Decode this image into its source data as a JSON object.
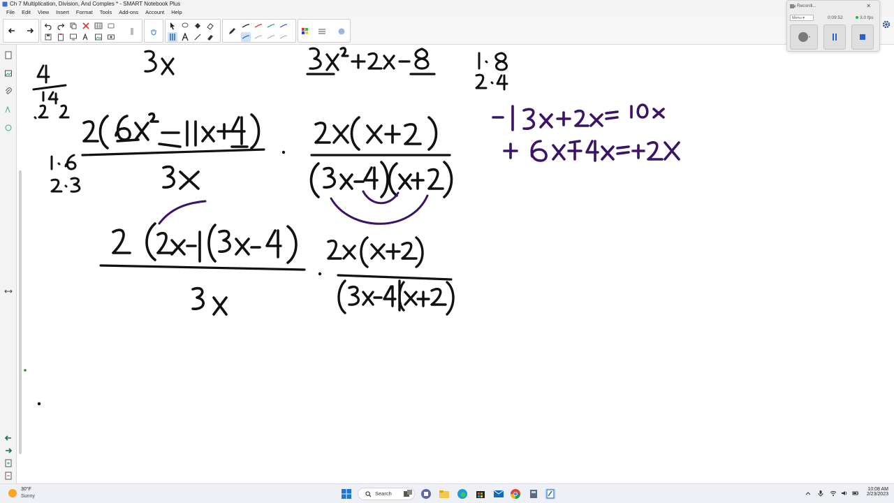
{
  "window": {
    "title": "Ch 7 Multiplication, Division, And Comples * - SMART Notebook Plus"
  },
  "menu": {
    "items": [
      "File",
      "Edit",
      "View",
      "Insert",
      "Format",
      "Tools",
      "Add-ons",
      "Account",
      "Help"
    ]
  },
  "recorder": {
    "title": "Recordi...",
    "menu_label": "Menu",
    "elapsed": "0:09:52",
    "fps": "3.0 fps"
  },
  "taskbar": {
    "weather_temp": "30°F",
    "weather_condition": "Sunny",
    "search_label": "Search",
    "time": "10:08 AM",
    "date": "2/23/2023"
  },
  "colors": {
    "ink_black": "#111111",
    "ink_purple": "#3a1466",
    "accent": "#0078d4"
  }
}
